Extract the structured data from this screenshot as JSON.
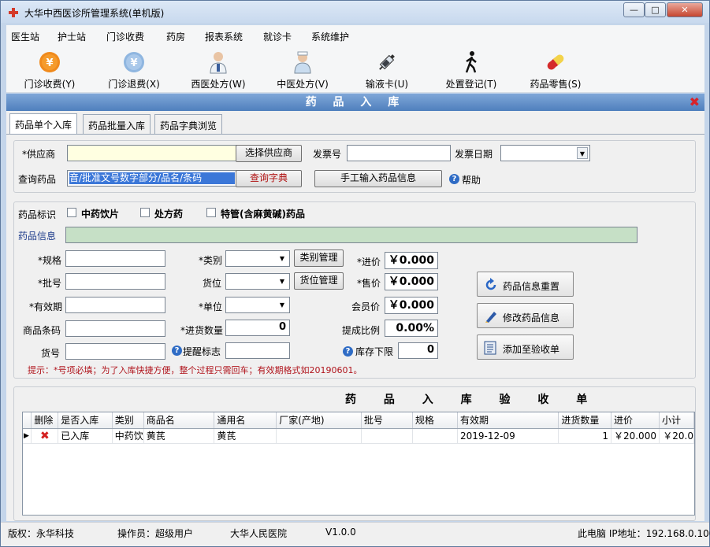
{
  "window": {
    "title": "大华中西医诊所管理系统(单机版)",
    "controls": {
      "minimize": "—",
      "restore": "□",
      "close": "✕"
    }
  },
  "menu": [
    "医生站",
    "护士站",
    "门诊收费",
    "药房",
    "报表系统",
    "就诊卡",
    "系统维护"
  ],
  "toolbar": [
    {
      "label": "门诊收费(Y)",
      "icon": "yen-coin-orange-icon"
    },
    {
      "label": "门诊退费(X)",
      "icon": "yen-coin-blue-icon"
    },
    {
      "label": "西医处方(W)",
      "icon": "doctor-icon"
    },
    {
      "label": "中医处方(V)",
      "icon": "nurse-icon"
    },
    {
      "label": "输液卡(U)",
      "icon": "syringe-icon"
    },
    {
      "label": "处置登记(T)",
      "icon": "walking-person-icon"
    },
    {
      "label": "药品零售(S)",
      "icon": "pill-capsule-icon"
    }
  ],
  "section": {
    "title": "药 品 入 库",
    "close": "✖"
  },
  "tabs": [
    "药品单个入库",
    "药品批量入库",
    "药品字典浏览"
  ],
  "supplier": {
    "label": "*供应商",
    "value": "",
    "select_button": "选择供应商",
    "invoice_no_label": "发票号",
    "invoice_no_value": "",
    "invoice_date_label": "发票日期",
    "invoice_date_value": "",
    "query_label": "查询药品",
    "query_value": "音/批准文号数字部分/品名/条码",
    "query_dict_button": "查询字典",
    "manual_button": "手工输入药品信息",
    "help": "帮助"
  },
  "drug": {
    "flag_label": "药品标识",
    "flags": [
      "中药饮片",
      "处方药",
      "特管(含麻黄碱)药品"
    ],
    "info_label": "药品信息",
    "info_value": "",
    "fields": {
      "spec": {
        "label": "*规格",
        "value": ""
      },
      "batch": {
        "label": "*批号",
        "value": ""
      },
      "expiry": {
        "label": "*有效期",
        "value": ""
      },
      "barcode": {
        "label": "商品条码",
        "value": ""
      },
      "shelf_no": {
        "label": "货号",
        "value": ""
      },
      "category": {
        "label": "*类别",
        "value": ""
      },
      "location": {
        "label": "货位",
        "value": ""
      },
      "unit": {
        "label": "*单位",
        "value": ""
      },
      "qty": {
        "label": "*进货数量",
        "value": "0"
      },
      "reminder": {
        "label": "提醒标志",
        "value": ""
      },
      "cost": {
        "label": "*进价",
        "value": "￥0.000"
      },
      "price": {
        "label": "*售价",
        "value": "￥0.000"
      },
      "member_price": {
        "label": "会员价",
        "value": "￥0.000"
      },
      "margin": {
        "label": "提成比例",
        "value": "0.00%"
      },
      "stock_min": {
        "label": "库存下限",
        "value": "0"
      }
    },
    "category_mgmt_button": "类别管理",
    "location_mgmt_button": "货位管理",
    "reset_button": "药品信息重置",
    "edit_button": "修改药品信息",
    "add_button": "添加至验收单",
    "hint": "提示：*号项必填；为了入库快捷方便，整个过程只需回车；有效期格式如20190601。"
  },
  "receipt": {
    "title": "药 品 入 库 验 收 单",
    "columns": [
      "删除",
      "是否入库",
      "类别",
      "商品名",
      "通用名",
      "厂家(产地)",
      "批号",
      "规格",
      "有效期",
      "进货数量",
      "进价",
      "小计"
    ],
    "rows": [
      [
        "",
        "已入库",
        "中药饮",
        "黄芪",
        "黄芪",
        "",
        "",
        "",
        "2019-12-09",
        "1",
        "￥20.000",
        "￥20.0"
      ]
    ]
  },
  "status": {
    "copyright": "版权：永华科技",
    "operator": "操作员：超级用户",
    "hospital": "大华人民医院",
    "version": "V1.0.0",
    "ip": "此电脑 IP地址：192.168.0.100"
  },
  "colors": {
    "title_gradient": "#4f7fbd",
    "close_red": "#d8232a",
    "hint_red": "#b0141c",
    "drug_info_green": "#c6e0c6"
  }
}
